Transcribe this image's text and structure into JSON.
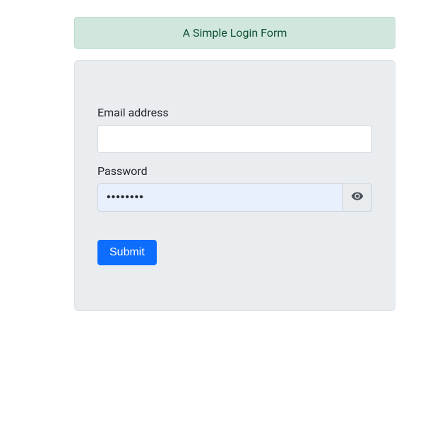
{
  "header": {
    "title": "A Simple Login Form"
  },
  "form": {
    "email": {
      "label": "Email address",
      "value": ""
    },
    "password": {
      "label": "Password",
      "value": "••••••••"
    },
    "submit_label": "Submit"
  }
}
